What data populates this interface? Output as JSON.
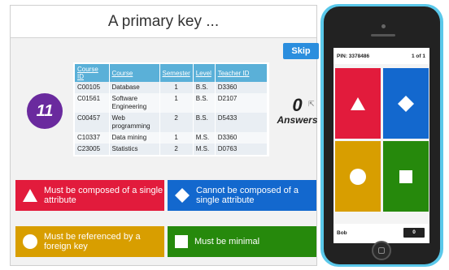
{
  "question": {
    "title": "A primary key ...",
    "skip_label": "Skip",
    "timer": "11",
    "answers_count": "0",
    "answers_label": "Answers"
  },
  "table": {
    "headers": [
      "Course ID",
      "Course",
      "Semester",
      "Level",
      "Teacher ID"
    ],
    "rows": [
      [
        "C00105",
        "Database",
        "1",
        "B.S.",
        "D3360"
      ],
      [
        "C01561",
        "Software Engineering",
        "1",
        "B.S.",
        "D2107"
      ],
      [
        "C00457",
        "Web programming",
        "2",
        "B.S.",
        "D5433"
      ],
      [
        "C10337",
        "Data mining",
        "1",
        "M.S.",
        "D3360"
      ],
      [
        "C23005",
        "Statistics",
        "2",
        "M.S.",
        "D0763"
      ]
    ]
  },
  "answers": [
    {
      "text": "Must be composed of a single attribute",
      "color": "#e21b3c",
      "icon": "triangle-icon"
    },
    {
      "text": "Cannot be composed of a single attribute",
      "color": "#1368ce",
      "icon": "diamond-icon"
    },
    {
      "text": "Must be referenced by a foreign key",
      "color": "#d89e00",
      "icon": "circle-icon"
    },
    {
      "text": "Must be minimal",
      "color": "#26890c",
      "icon": "square-icon"
    }
  ],
  "phone": {
    "pin": "PIN: 3378486",
    "page": "1 of 1",
    "player": "Bob",
    "score": "0"
  }
}
